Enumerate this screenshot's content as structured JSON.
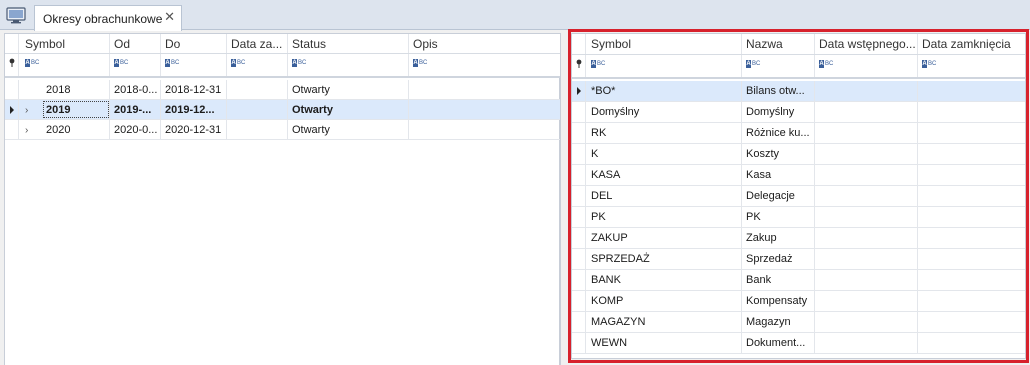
{
  "tabs": [
    {
      "label": "Okresy obrachunkowe",
      "close": "✕"
    }
  ],
  "left_grid": {
    "columns": [
      "Symbol",
      "Od",
      "Do",
      "Data za...",
      "Status",
      "Opis"
    ],
    "filter_icon": "abc-filter-icon",
    "rows": [
      {
        "symbol": "2018",
        "od": "2018-0...",
        "do": "2018-12-31",
        "data_za": "",
        "status": "Otwarty",
        "opis": ""
      },
      {
        "symbol": "2019",
        "od": "2019-...",
        "do": "2019-12...",
        "data_za": "",
        "status": "Otwarty",
        "opis": ""
      },
      {
        "symbol": "2020",
        "od": "2020-0...",
        "do": "2020-12-31",
        "data_za": "",
        "status": "Otwarty",
        "opis": ""
      }
    ],
    "selected_row": 1
  },
  "right_grid": {
    "columns": [
      "Symbol",
      "Nazwa",
      "Data wstępnego...",
      "Data zamknięcia"
    ],
    "rows": [
      {
        "symbol": "*BO*",
        "nazwa": "Bilans otw...",
        "data_wst": "",
        "data_zam": ""
      },
      {
        "symbol": "Domyślny",
        "nazwa": "Domyślny",
        "data_wst": "",
        "data_zam": ""
      },
      {
        "symbol": "RK",
        "nazwa": "Różnice ku...",
        "data_wst": "",
        "data_zam": ""
      },
      {
        "symbol": "K",
        "nazwa": "Koszty",
        "data_wst": "",
        "data_zam": ""
      },
      {
        "symbol": "KASA",
        "nazwa": "Kasa",
        "data_wst": "",
        "data_zam": ""
      },
      {
        "symbol": "DEL",
        "nazwa": "Delegacje",
        "data_wst": "",
        "data_zam": ""
      },
      {
        "symbol": "PK",
        "nazwa": "PK",
        "data_wst": "",
        "data_zam": ""
      },
      {
        "symbol": "ZAKUP",
        "nazwa": "Zakup",
        "data_wst": "",
        "data_zam": ""
      },
      {
        "symbol": "SPRZEDAŻ",
        "nazwa": "Sprzedaż",
        "data_wst": "",
        "data_zam": ""
      },
      {
        "symbol": "BANK",
        "nazwa": "Bank",
        "data_wst": "",
        "data_zam": ""
      },
      {
        "symbol": "KOMP",
        "nazwa": "Kompensaty",
        "data_wst": "",
        "data_zam": ""
      },
      {
        "symbol": "MAGAZYN",
        "nazwa": "Magazyn",
        "data_wst": "",
        "data_zam": ""
      },
      {
        "symbol": "WEWN",
        "nazwa": "Dokument...",
        "data_wst": "",
        "data_zam": ""
      }
    ],
    "selected_row": 0
  },
  "colors": {
    "highlight_frame": "#d7212c",
    "selection": "#dbe9fb"
  }
}
